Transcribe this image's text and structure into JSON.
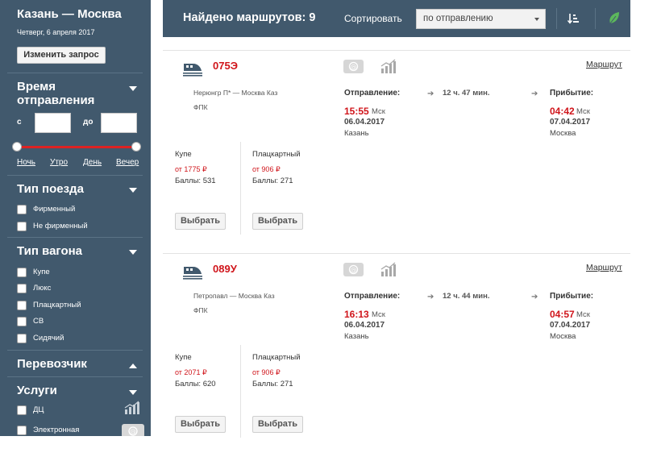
{
  "sidebar": {
    "route": "Казань — Москва",
    "date": "Четверг, 6 апреля 2017",
    "change_button": "Изменить запрос",
    "departure_time": {
      "title_line1": "Время",
      "title_line2": "отправления",
      "from_label": "с",
      "to_label": "до",
      "from_value": "",
      "to_value": "",
      "slider_min": 0,
      "slider_max": 1,
      "times_of_day": [
        "Ночь",
        "Утро",
        "День",
        "Вечер"
      ]
    },
    "train_type": {
      "title": "Тип поезда",
      "options": [
        "Фирменный",
        "Не фирменный"
      ]
    },
    "car_type": {
      "title": "Тип вагона",
      "options": [
        "Купе",
        "Люкс",
        "Плацкартный",
        "СВ",
        "Сидячий"
      ]
    },
    "carrier": {
      "title": "Перевозчик"
    },
    "services": {
      "title": "Услуги",
      "options": [
        "ДЦ",
        "Электронная"
      ]
    }
  },
  "topbar": {
    "found": "Найдено маршрутов: 9",
    "sort_label": "Сортировать",
    "sort_value": "по отправлению"
  },
  "labels": {
    "route_link": "Маршрут",
    "departure": "Отправление:",
    "arrival": "Прибытие:",
    "tz": "Мск",
    "pick": "Выбрать"
  },
  "trains": [
    {
      "number": "075Э",
      "route": "Нерюнгр П* — Москва Каз",
      "carrier": "ФПК",
      "duration": "12 ч. 47 мин.",
      "dep_time": "15:55",
      "dep_date": "06.04.2017",
      "dep_city": "Казань",
      "arr_time": "04:42",
      "arr_date": "07.04.2017",
      "arr_city": "Москва",
      "seats": [
        {
          "type": "Купе",
          "price": "от 1775 ₽",
          "points": "Баллы: 531"
        },
        {
          "type": "Плацкартный",
          "price": "от 906 ₽",
          "points": "Баллы: 271"
        }
      ]
    },
    {
      "number": "089У",
      "route": "Петропавл — Москва Каз",
      "carrier": "ФПК",
      "duration": "12 ч. 44 мин.",
      "dep_time": "16:13",
      "dep_date": "06.04.2017",
      "dep_city": "Казань",
      "arr_time": "04:57",
      "arr_date": "07.04.2017",
      "arr_city": "Москва",
      "seats": [
        {
          "type": "Купе",
          "price": "от 2071 ₽",
          "points": "Баллы: 620"
        },
        {
          "type": "Плацкартный",
          "price": "от 906 ₽",
          "points": "Баллы: 271"
        }
      ]
    }
  ],
  "icons": {
    "ticket": "ticket-icon",
    "chart": "bar-chart-icon",
    "train": "train-icon",
    "leaf": "leaf-icon",
    "sort": "sort-icon"
  },
  "colors": {
    "panel": "#41596d",
    "accent_red": "#d0151b",
    "leaf_green": "#5cb85c"
  }
}
